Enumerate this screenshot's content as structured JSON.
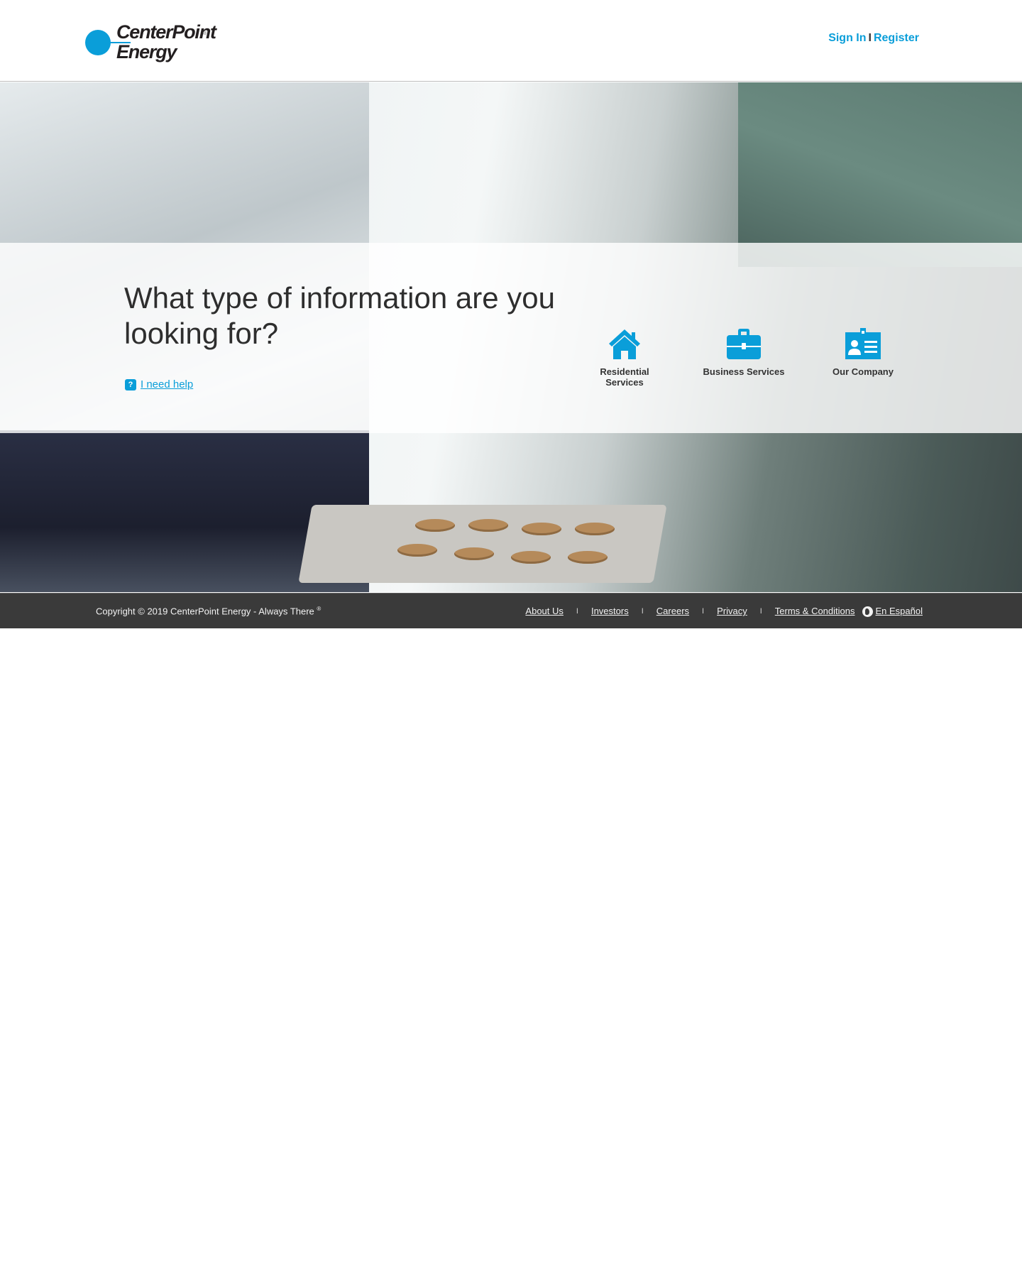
{
  "header": {
    "logo": {
      "line1": "CenterPoint",
      "line2": "Energy",
      "reg": "®"
    },
    "sign_in": "Sign In",
    "separator": "I",
    "register": "Register"
  },
  "hero": {
    "question": "What type of information are you looking for?",
    "help_icon": "?",
    "help_text": "I need help",
    "services": [
      {
        "label": "Residential Services",
        "icon": "house-icon"
      },
      {
        "label": "Business Services",
        "icon": "briefcase-icon"
      },
      {
        "label": "Our Company",
        "icon": "id-card-icon"
      }
    ]
  },
  "footer": {
    "copyright": "Copyright © 2019 CenterPoint Energy - Always There",
    "copyright_mark": "®",
    "links": {
      "about": "About Us",
      "investors": "Investors",
      "careers": "Careers",
      "privacy": "Privacy",
      "terms": "Terms & Conditions",
      "espanol": "En Español"
    },
    "separator": "I"
  },
  "colors": {
    "brand": "#0a9ed9",
    "footer_bg": "#3a3a3a",
    "text": "#333333"
  }
}
